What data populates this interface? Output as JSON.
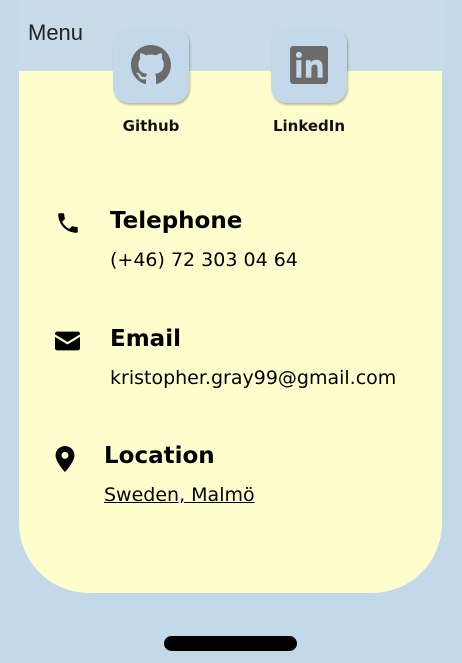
{
  "header": {
    "menu_label": "Menu"
  },
  "social": {
    "github": {
      "label": "Github",
      "icon": "github-icon"
    },
    "linkedin": {
      "label": "LinkedIn",
      "icon": "linkedin-icon"
    }
  },
  "contact": {
    "telephone": {
      "title": "Telephone",
      "value": "(+46) 72 303 04 64",
      "icon": "phone-icon"
    },
    "email": {
      "title": "Email",
      "value": "kristopher.gray99@gmail.com",
      "icon": "envelope-icon"
    },
    "location": {
      "title": "Location",
      "value": "Sweden, Malmö",
      "icon": "map-pin-icon"
    }
  },
  "colors": {
    "background": "#c3d9ea",
    "card": "#ffffcd",
    "icon_tile": "#c3d9ea",
    "icon_glyph": "#6b6b6b"
  }
}
